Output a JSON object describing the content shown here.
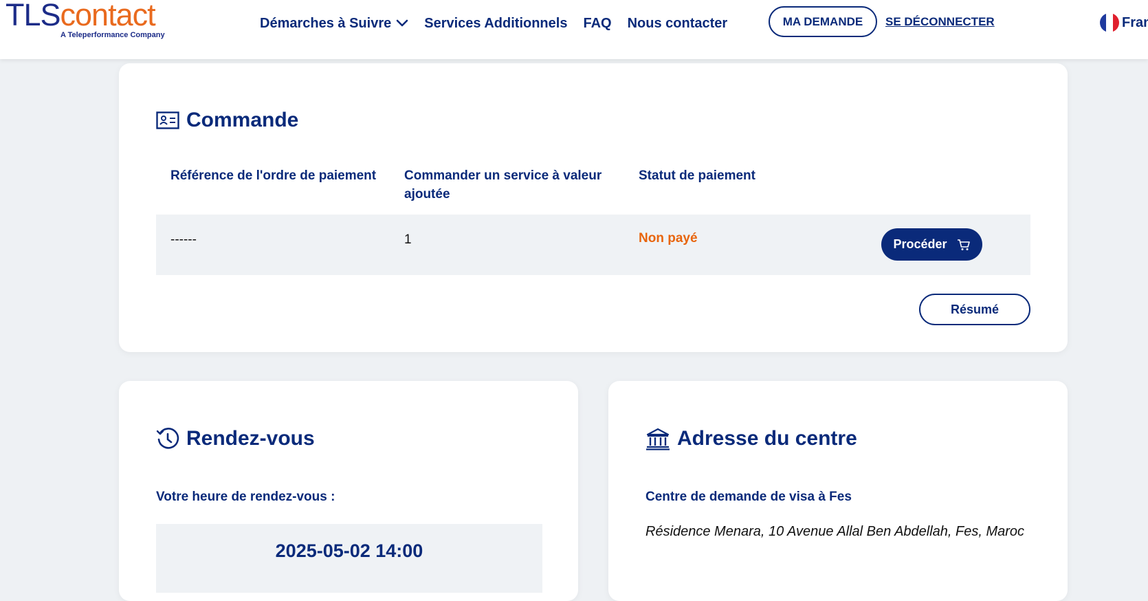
{
  "header": {
    "logo_tls": "TLS",
    "logo_contact": "contact",
    "logo_sub": "A Teleperformance Company",
    "nav": [
      {
        "label": "Démarches à Suivre"
      },
      {
        "label": "Services Additionnels"
      },
      {
        "label": "FAQ"
      },
      {
        "label": "Nous contacter"
      }
    ],
    "my_request_label": "MA DEMANDE",
    "logout_label": "SE DÉCONNECTER",
    "language_label": "Fran"
  },
  "commande": {
    "title": "Commande",
    "columns": [
      "Référence de l'ordre de paiement",
      "Commander un service à valeur ajoutée",
      "Statut de paiement"
    ],
    "row": {
      "reference": "------",
      "service_count": "1",
      "status": "Non payé",
      "proceed_label": "Procéder"
    },
    "summary_label": "Résumé"
  },
  "rendezvous": {
    "title": "Rendez-vous",
    "label": "Votre heure de rendez-vous :",
    "datetime": "2025-05-02 14:00"
  },
  "centre": {
    "title": "Adresse du centre",
    "name": "Centre de demande de visa à Fes",
    "address": "Résidence Menara, 10 Avenue Allal Ben Abdellah, Fes, Maroc"
  },
  "colors": {
    "primary": "#0a2a7a",
    "accent": "#e96a1e",
    "unpaid": "#e8650e",
    "background": "#eef1f4"
  },
  "icons": [
    "chevron-down-icon",
    "id-card-icon",
    "cart-icon",
    "clock-history-icon",
    "bank-building-icon",
    "france-flag-icon"
  ]
}
